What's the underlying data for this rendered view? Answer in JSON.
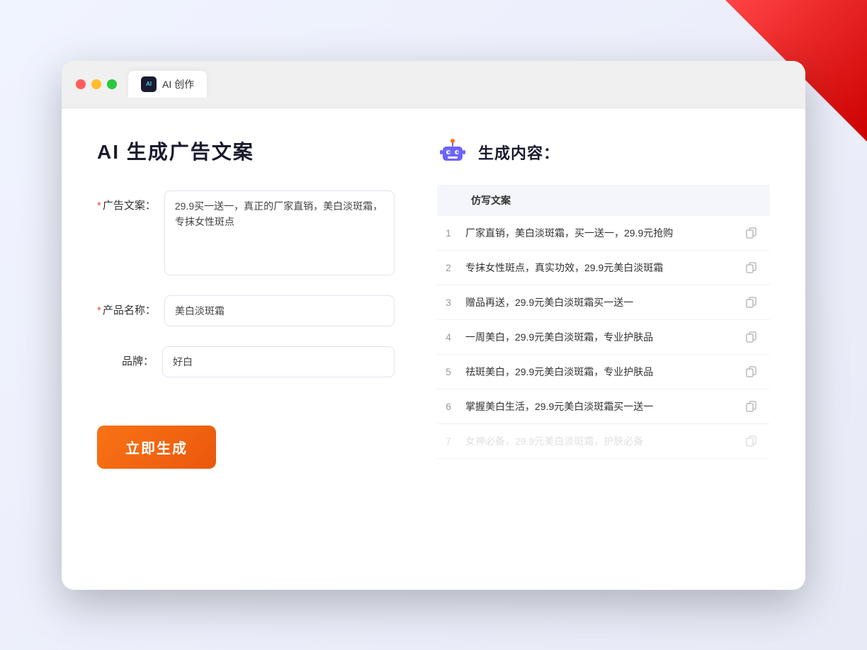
{
  "window": {
    "tab_label": "AI 创作"
  },
  "page": {
    "title": "AI 生成广告文案"
  },
  "form": {
    "ad_copy_label": "广告文案：",
    "ad_copy_required": "*",
    "ad_copy_value": "29.9买一送一，真正的厂家直销，美白淡斑霜，专抹女性斑点",
    "product_name_label": "产品名称：",
    "product_name_required": "*",
    "product_name_value": "美白淡斑霜",
    "brand_label": "品牌：",
    "brand_value": "好白",
    "generate_btn_label": "立即生成"
  },
  "result": {
    "header_label": "生成内容：",
    "column_label": "仿写文案",
    "items": [
      {
        "index": 1,
        "text": "厂家直销，美白淡斑霜，买一送一，29.9元抢购"
      },
      {
        "index": 2,
        "text": "专抹女性斑点，真实功效，29.9元美白淡斑霜"
      },
      {
        "index": 3,
        "text": "赠品再送，29.9元美白淡斑霜买一送一"
      },
      {
        "index": 4,
        "text": "一周美白，29.9元美白淡斑霜，专业护肤品"
      },
      {
        "index": 5,
        "text": "祛斑美白，29.9元美白淡斑霜，专业护肤品"
      },
      {
        "index": 6,
        "text": "掌握美白生活，29.9元美白淡斑霜买一送一"
      },
      {
        "index": 7,
        "text": "女神必备，29.9元美白淡斑霜，护肤必备",
        "faded": true
      }
    ]
  }
}
